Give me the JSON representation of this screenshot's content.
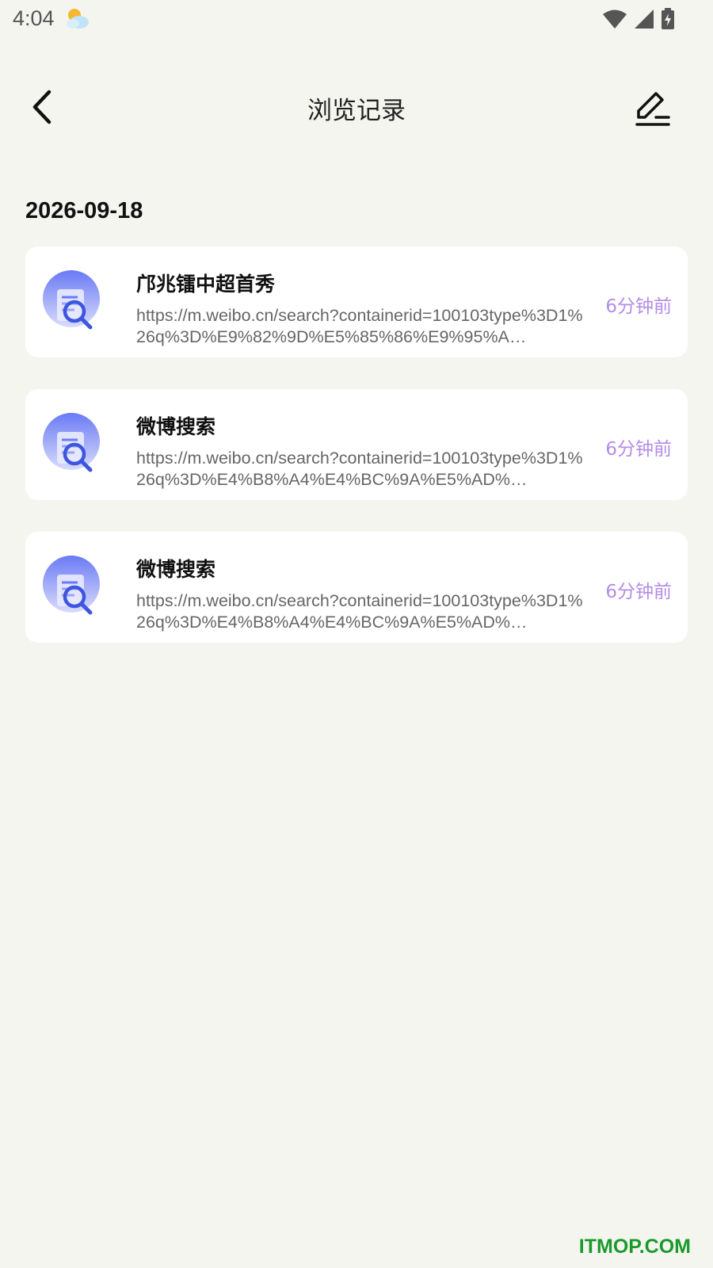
{
  "status_bar": {
    "time": "4:04",
    "weather_icon": "partly-cloudy-icon",
    "wifi_icon": "wifi-icon",
    "signal_icon": "cell-signal-icon",
    "battery_icon": "battery-charging-icon"
  },
  "header": {
    "title": "浏览记录",
    "back_icon": "chevron-left-icon",
    "edit_icon": "edit-icon"
  },
  "date_group": "2026-09-18",
  "items": [
    {
      "title": "邝兆镭中超首秀",
      "url": "https://m.weibo.cn/search?containerid=100103type%3D1%26q%3D%E9%82%9D%E5%85%86%E9%95%A…",
      "time": "6分钟前",
      "icon": "search-document-icon"
    },
    {
      "title": "微博搜索",
      "url": "https://m.weibo.cn/search?containerid=100103type%3D1%26q%3D%E4%B8%A4%E4%BC%9A%E5%AD%…",
      "time": "6分钟前",
      "icon": "search-document-icon"
    },
    {
      "title": "微博搜索",
      "url": "https://m.weibo.cn/search?containerid=100103type%3D1%26q%3D%E4%B8%A4%E4%BC%9A%E5%AD%…",
      "time": "6分钟前",
      "icon": "search-document-icon"
    }
  ],
  "watermark": "ITMOP.COM",
  "colors": {
    "background": "#f5f5f0",
    "card": "#ffffff",
    "time_accent": "#b48ce8",
    "icon_accent": "#5b6ef0",
    "watermark": "#1a9a2a"
  }
}
